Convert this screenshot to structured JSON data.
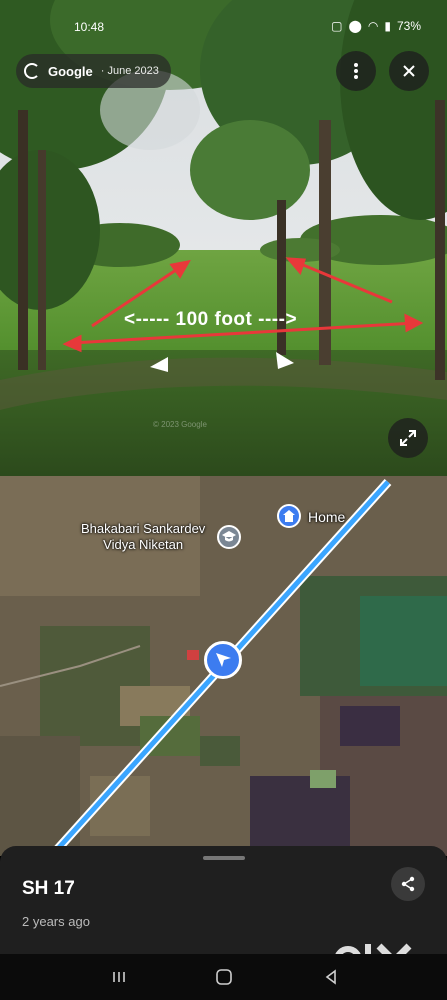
{
  "status_bar": {
    "time": "10:48",
    "battery": "73%"
  },
  "street_view": {
    "brand": "Google",
    "date_label": "· June 2023",
    "annotation": "<----- 100 foot ---->",
    "watermark": "© 2023 Google"
  },
  "map": {
    "poi_school": "Bhakabari Sankardev\nVidya Niketan",
    "poi_home": "Home",
    "road_color": "#3aa5ff"
  },
  "sheet": {
    "title": "SH 17",
    "subtitle": "2 years ago"
  },
  "icons": {
    "menu": "more-vertical-icon",
    "close": "close-icon",
    "expand": "expand-icon",
    "share": "share-icon",
    "navigation": "navigation-arrow-icon",
    "school": "school-icon",
    "home": "home-icon"
  },
  "watermark_logo": "OLX"
}
